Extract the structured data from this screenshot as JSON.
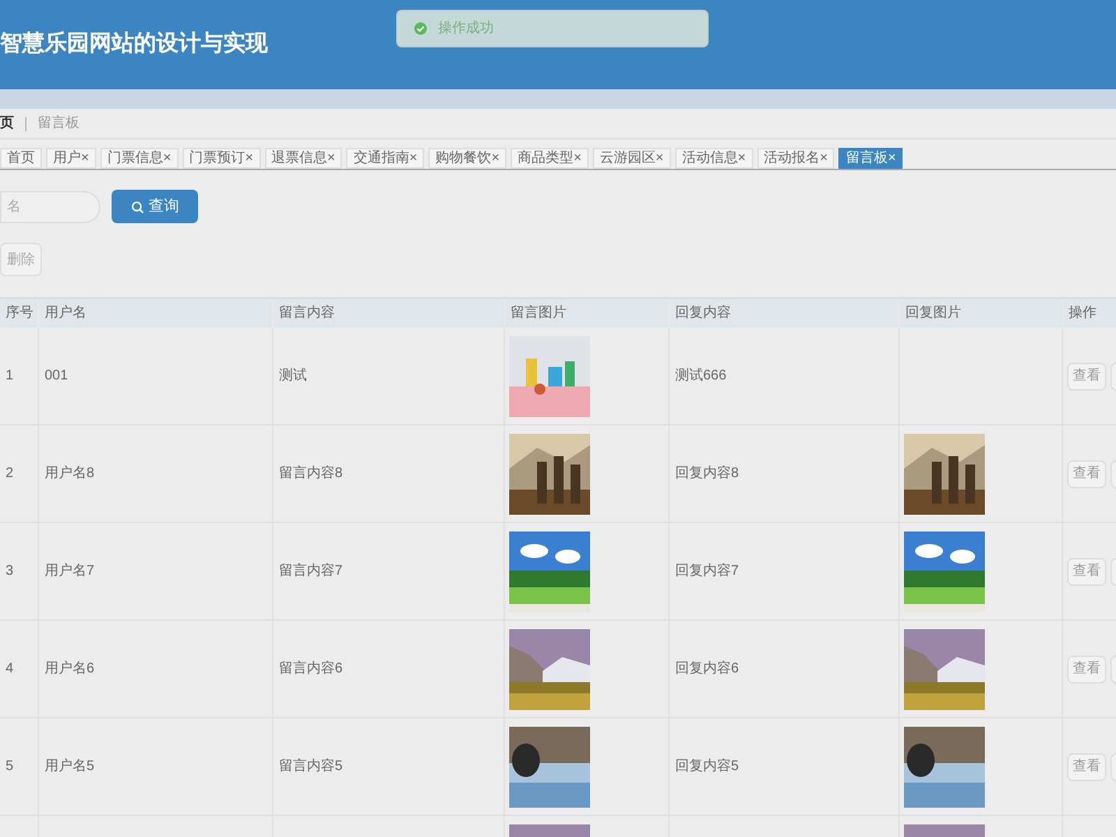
{
  "header": {
    "title": "智慧乐园网站的设计与实现"
  },
  "toast": {
    "message": "操作成功"
  },
  "breadcrumb": [
    "页",
    "留言板"
  ],
  "tabs": [
    {
      "label": "首页",
      "selected": false
    },
    {
      "label": "用户×",
      "selected": false
    },
    {
      "label": "门票信息×",
      "selected": false
    },
    {
      "label": "门票预订×",
      "selected": false
    },
    {
      "label": "退票信息×",
      "selected": false
    },
    {
      "label": "交通指南×",
      "selected": false
    },
    {
      "label": "购物餐饮×",
      "selected": false
    },
    {
      "label": "商品类型×",
      "selected": false
    },
    {
      "label": "云游园区×",
      "selected": false
    },
    {
      "label": "活动信息×",
      "selected": false
    },
    {
      "label": "活动报名×",
      "selected": false
    },
    {
      "label": "留言板×",
      "selected": true
    }
  ],
  "search": {
    "placeholder": "名",
    "button": "查询"
  },
  "delete_button": "删除",
  "table": {
    "columns": [
      "序号",
      "用户名",
      "留言内容",
      "留言图片",
      "回复内容",
      "回复图片",
      "操作"
    ],
    "rows": [
      {
        "index": "1",
        "username": "001",
        "message": "测试",
        "message_image": {
          "kind": "toys"
        },
        "reply": "测试666",
        "view": "查看"
      },
      {
        "index": "2",
        "username": "用户名8",
        "message": "留言内容8",
        "message_image": {
          "kind": "people"
        },
        "reply": "回复内容8",
        "reply_image": {
          "kind": "people"
        },
        "view": "查看"
      },
      {
        "index": "3",
        "username": "用户名7",
        "message": "留言内容7",
        "message_image": {
          "kind": "meadow"
        },
        "reply": "回复内容7",
        "reply_image": {
          "kind": "meadow"
        },
        "view": "查看"
      },
      {
        "index": "4",
        "username": "用户名6",
        "message": "留言内容6",
        "message_image": {
          "kind": "mountain"
        },
        "reply": "回复内容6",
        "reply_image": {
          "kind": "mountain"
        },
        "view": "查看"
      },
      {
        "index": "5",
        "username": "用户名5",
        "message": "留言内容5",
        "message_image": {
          "kind": "lake"
        },
        "reply": "回复内容5",
        "reply_image": {
          "kind": "lake"
        },
        "view": "查看"
      },
      {
        "message_image": {
          "kind": "mountain"
        },
        "reply_image": {
          "kind": "mountain"
        }
      }
    ]
  }
}
